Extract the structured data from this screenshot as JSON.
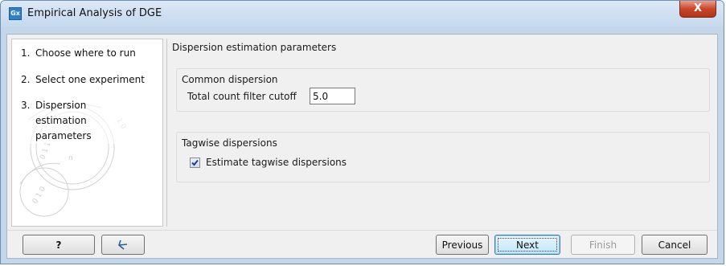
{
  "window": {
    "title": "Empirical Analysis of DGE",
    "app_icon_text": "Gx",
    "close_label": "X"
  },
  "sidebar": {
    "steps": [
      {
        "number": "1.",
        "label": "Choose where to run"
      },
      {
        "number": "2.",
        "label": "Select one experiment"
      },
      {
        "number": "3.",
        "label": "Dispersion estimation parameters"
      }
    ]
  },
  "main": {
    "section_title": "Dispersion estimation parameters",
    "common_dispersion": {
      "title": "Common dispersion",
      "cutoff_label": "Total count filter cutoff",
      "cutoff_value": "5.0"
    },
    "tagwise_dispersions": {
      "title": "Tagwise dispersions",
      "checkbox_label": "Estimate tagwise dispersions",
      "checked": true
    }
  },
  "footer": {
    "help_label": "?",
    "previous_label": "Previous",
    "next_label": "Next",
    "finish_label": "Finish",
    "cancel_label": "Cancel"
  },
  "colors": {
    "titlebar": "#c6d9ee",
    "close": "#c9462c",
    "dialog_bg": "#f0f0f0",
    "default_button": "#bee6fd"
  }
}
